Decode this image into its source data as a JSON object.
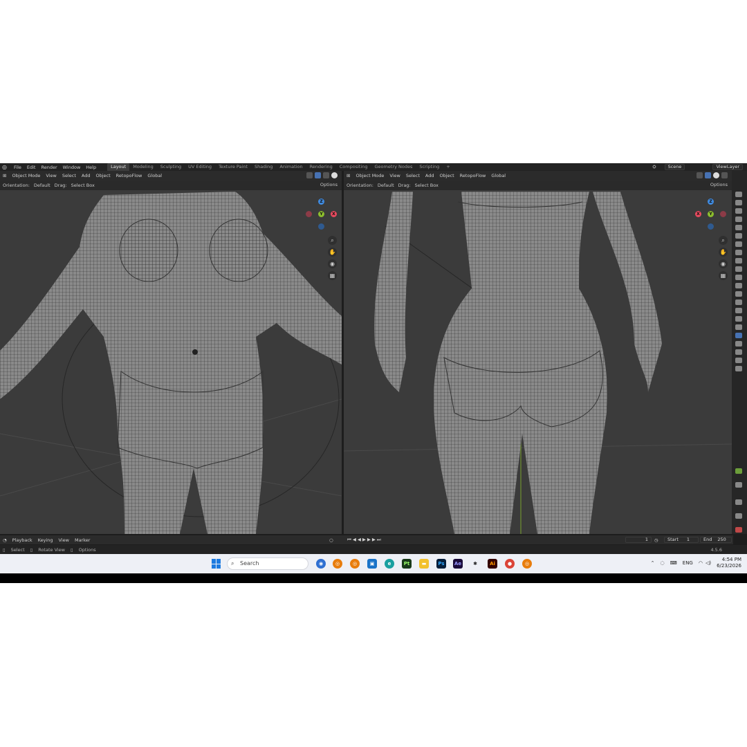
{
  "menu": [
    "File",
    "Edit",
    "Render",
    "Window",
    "Help"
  ],
  "workspaces": [
    "Layout",
    "Modeling",
    "Sculpting",
    "UV Editing",
    "Texture Paint",
    "Shading",
    "Animation",
    "Rendering",
    "Compositing",
    "Geometry Nodes",
    "Scripting",
    "+"
  ],
  "scene": "Scene",
  "view_layer": "ViewLayer",
  "viewport": {
    "mode": "Object Mode",
    "menus": [
      "View",
      "Select",
      "Add",
      "Object",
      "RetopoFlow"
    ],
    "transform": "Global",
    "orientation_label": "Orientation:",
    "orientation_value": "Default",
    "drag_label": "Drag:",
    "drag_value": "Select Box",
    "options": "Options",
    "axes": {
      "x": "X",
      "y": "Y",
      "z": "Z"
    }
  },
  "timeline": {
    "menus": [
      "Playback",
      "Keying",
      "View",
      "Marker"
    ],
    "current_frame": "1",
    "start_label": "Start",
    "start_value": "1",
    "end_label": "End",
    "end_value": "250"
  },
  "status": {
    "select": "Select",
    "rotate": "Rotate View",
    "options": "Options",
    "version": "4.5.6"
  },
  "taskbar": {
    "search_placeholder": "Search",
    "apps": [
      "Pt",
      "Ps",
      "Ae",
      "Ai"
    ],
    "language": "ENG",
    "time": "4:54 PM",
    "date": "6/23/2026"
  },
  "colors": {
    "axis_x": "#e84a5f",
    "axis_y": "#8cbd2e",
    "axis_z": "#3f8ae0",
    "viewport_bg": "#3b3b3b",
    "accent": "#4772b3"
  }
}
